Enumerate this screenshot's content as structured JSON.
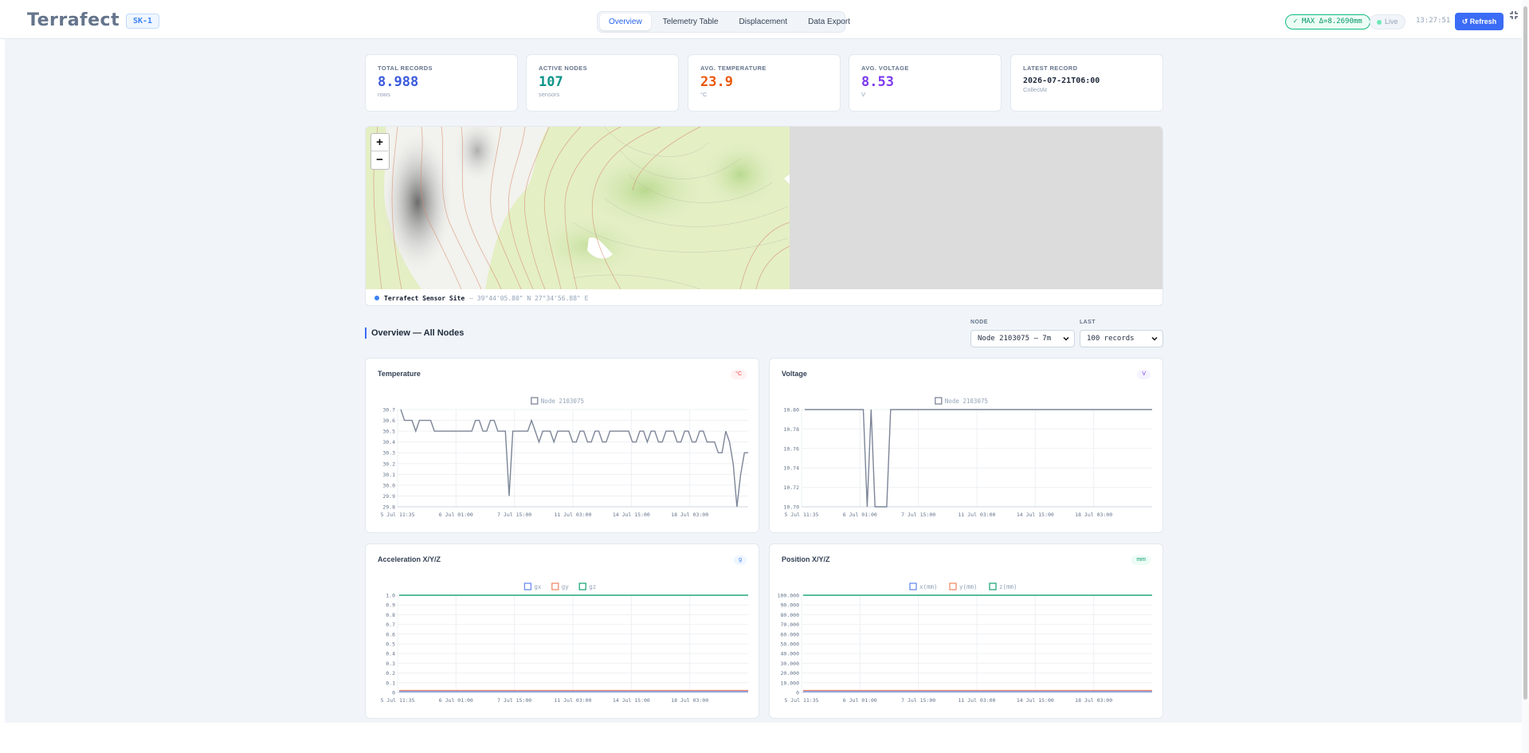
{
  "header": {
    "logo": "Terrafect",
    "site_badge": "SK-1",
    "tabs": [
      {
        "label": "Overview",
        "active": true
      },
      {
        "label": "Telemetry Table",
        "active": false
      },
      {
        "label": "Displacement",
        "active": false
      },
      {
        "label": "Data Export",
        "active": false
      }
    ],
    "max_badge": "✓ MAX Δ=8.2690mm",
    "live_label": "Live",
    "clock": "13:27:51",
    "refresh_label": "↺ Refresh",
    "collapse_icon": "collapse-arrows-icon"
  },
  "stats": [
    {
      "label": "TOTAL RECORDS",
      "value": "8.988",
      "sub": "rows",
      "color": "#3b5bdb"
    },
    {
      "label": "ACTIVE NODES",
      "value": "107",
      "sub": "sensors",
      "color": "#0d9488"
    },
    {
      "label": "AVG. TEMPERATURE",
      "value": "23.9",
      "sub": "°C",
      "color": "#ea580c"
    },
    {
      "label": "AVG. VOLTAGE",
      "value": "8.53",
      "sub": "V",
      "color": "#7c3aed"
    },
    {
      "label": "LATEST RECORD",
      "value": "2026-07-21T06:00",
      "sub": "CollectAt",
      "color": "#1e293b"
    }
  ],
  "map": {
    "zoom_in": "+",
    "zoom_out": "−",
    "site_name": "Terrafect Sensor Site",
    "site_coords": "— 39°44'05.80\" N 27°34'56.88\" E"
  },
  "overview": {
    "title": "Overview — All Nodes",
    "node_label": "NODE",
    "node_value": "Node 2103075 — 7m",
    "last_label": "LAST",
    "last_value": "100 records"
  },
  "chart_data": [
    {
      "type": "line",
      "title": "Temperature",
      "unit": "°C",
      "unit_color": "#ef4444",
      "unit_bg": "#fef2f2",
      "yticks": [
        "29.8",
        "29.9",
        "30.0",
        "30.1",
        "30.2",
        "30.3",
        "30.4",
        "30.5",
        "30.6",
        "30.7"
      ],
      "ylim": [
        29.8,
        30.7
      ],
      "xticks": [
        "5 Jul 11:35",
        "6 Jul 01:00",
        "7 Jul 15:00",
        "11 Jul 03:00",
        "14 Jul 15:00",
        "18 Jul 03:00"
      ],
      "legend_position": "top-center",
      "series": [
        {
          "name": "Node 2103075",
          "color": "#7c8598",
          "values": [
            30.7,
            30.6,
            30.6,
            30.6,
            30.5,
            30.6,
            30.6,
            30.6,
            30.6,
            30.5,
            30.5,
            30.5,
            30.5,
            30.5,
            30.5,
            30.5,
            30.5,
            30.5,
            30.5,
            30.5,
            30.6,
            30.6,
            30.5,
            30.5,
            30.6,
            30.6,
            30.5,
            30.5,
            30.5,
            29.9,
            30.5,
            30.5,
            30.5,
            30.5,
            30.5,
            30.6,
            30.5,
            30.4,
            30.5,
            30.5,
            30.5,
            30.4,
            30.5,
            30.5,
            30.5,
            30.5,
            30.4,
            30.4,
            30.5,
            30.5,
            30.4,
            30.4,
            30.5,
            30.5,
            30.4,
            30.4,
            30.5,
            30.5,
            30.5,
            30.5,
            30.5,
            30.5,
            30.4,
            30.4,
            30.5,
            30.5,
            30.4,
            30.5,
            30.5,
            30.4,
            30.4,
            30.5,
            30.5,
            30.5,
            30.4,
            30.4,
            30.5,
            30.5,
            30.4,
            30.4,
            30.5,
            30.5,
            30.4,
            30.4,
            30.4,
            30.3,
            30.3,
            30.5,
            30.4,
            30.2,
            29.8,
            30.1,
            30.3,
            30.3
          ]
        }
      ]
    },
    {
      "type": "line",
      "title": "Voltage",
      "unit": "V",
      "unit_color": "#7c3aed",
      "unit_bg": "#f5f3ff",
      "yticks": [
        "10.70",
        "10.72",
        "10.74",
        "10.76",
        "10.78",
        "10.80"
      ],
      "ylim": [
        10.7,
        10.8
      ],
      "xticks": [
        "5 Jul 11:35",
        "6 Jul 01:00",
        "7 Jul 15:00",
        "11 Jul 03:00",
        "14 Jul 15:00",
        "18 Jul 03:00"
      ],
      "legend_position": "top-center",
      "series": [
        {
          "name": "Node 2103075",
          "color": "#7c8598",
          "values": [
            10.8,
            10.8,
            10.8,
            10.8,
            10.8,
            10.8,
            10.8,
            10.8,
            10.8,
            10.8,
            10.8,
            10.8,
            10.8,
            10.8,
            10.8,
            10.8,
            10.7,
            10.8,
            10.7,
            10.7,
            10.7,
            10.7,
            10.8,
            10.8,
            10.8,
            10.8,
            10.8,
            10.8,
            10.8,
            10.8,
            10.8,
            10.8,
            10.8,
            10.8,
            10.8,
            10.8,
            10.8,
            10.8,
            10.8,
            10.8,
            10.8,
            10.8,
            10.8,
            10.8,
            10.8,
            10.8,
            10.8,
            10.8,
            10.8,
            10.8,
            10.8,
            10.8,
            10.8,
            10.8,
            10.8,
            10.8,
            10.8,
            10.8,
            10.8,
            10.8,
            10.8,
            10.8,
            10.8,
            10.8,
            10.8,
            10.8,
            10.8,
            10.8,
            10.8,
            10.8,
            10.8,
            10.8,
            10.8,
            10.8,
            10.8,
            10.8,
            10.8,
            10.8,
            10.8,
            10.8,
            10.8,
            10.8,
            10.8,
            10.8,
            10.8,
            10.8,
            10.8,
            10.8,
            10.8,
            10.8
          ]
        }
      ]
    },
    {
      "type": "line",
      "title": "Acceleration X/Y/Z",
      "unit": "g",
      "unit_color": "#3b82f6",
      "unit_bg": "#eff6ff",
      "yticks": [
        "0",
        "0.1",
        "0.2",
        "0.3",
        "0.4",
        "0.5",
        "0.6",
        "0.7",
        "0.8",
        "0.9",
        "1.0"
      ],
      "ylim": [
        0,
        1.0
      ],
      "xticks": [
        "5 Jul 11:35",
        "6 Jul 01:00",
        "7 Jul 15:00",
        "11 Jul 03:00",
        "14 Jul 15:00",
        "18 Jul 03:00"
      ],
      "legend_position": "top-center",
      "series": [
        {
          "name": "gx",
          "color": "#6b8cf0",
          "constant": 0.01
        },
        {
          "name": "gy",
          "color": "#f08c6b",
          "constant": 0.02
        },
        {
          "name": "gz",
          "color": "#22a87a",
          "constant": 1.0
        }
      ]
    },
    {
      "type": "line",
      "title": "Position X/Y/Z",
      "unit": "mm",
      "unit_color": "#059669",
      "unit_bg": "#ecfdf5",
      "yticks": [
        "0",
        "10.000",
        "20.000",
        "30.000",
        "40.000",
        "50.000",
        "60.000",
        "70.000",
        "80.000",
        "90.000",
        "100.000"
      ],
      "ylim": [
        0,
        100000
      ],
      "xticks": [
        "5 Jul 11:35",
        "6 Jul 01:00",
        "7 Jul 15:00",
        "11 Jul 03:00",
        "14 Jul 15:00",
        "18 Jul 03:00"
      ],
      "legend_position": "top-center",
      "series": [
        {
          "name": "x(mm)",
          "color": "#6b8cf0",
          "constant": 1000
        },
        {
          "name": "y(mm)",
          "color": "#f08c6b",
          "constant": 2000
        },
        {
          "name": "z(mm)",
          "color": "#22a87a",
          "constant": 100000
        }
      ]
    }
  ]
}
